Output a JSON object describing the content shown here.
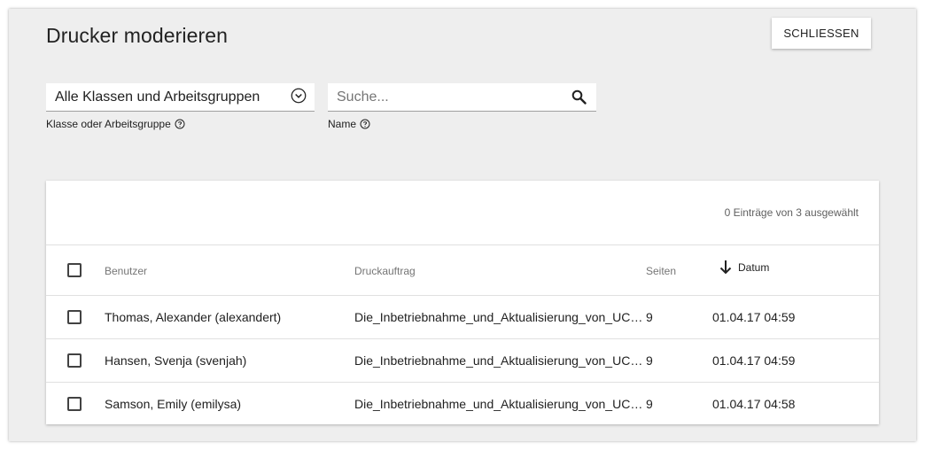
{
  "header": {
    "title": "Drucker moderieren",
    "close_label": "SCHLIESSEN"
  },
  "filters": {
    "class_select": {
      "value": "Alle Klassen und Arbeitsgruppen",
      "label": "Klasse oder Arbeitsgruppe"
    },
    "name_search": {
      "placeholder": "Suche...",
      "value": "",
      "label": "Name"
    }
  },
  "grid": {
    "selection_status": "0 Einträge von 3 ausgewählt",
    "columns": {
      "user": "Benutzer",
      "job": "Druckauftrag",
      "pages": "Seiten",
      "date": "Datum"
    },
    "sort": {
      "column": "date",
      "direction": "descending"
    },
    "rows": [
      {
        "user": "Thomas, Alexander (alexandert)",
        "job": "Die_Inbetriebnahme_und_Aktualisierung_von_UCS_...",
        "pages": "9",
        "date": "01.04.17 04:59"
      },
      {
        "user": "Hansen, Svenja (svenjah)",
        "job": "Die_Inbetriebnahme_und_Aktualisierung_von_UCS_...",
        "pages": "9",
        "date": "01.04.17 04:59"
      },
      {
        "user": "Samson, Emily (emilysa)",
        "job": "Die_Inbetriebnahme_und_Aktualisierung_von_UCS_...",
        "pages": "9",
        "date": "01.04.17 04:58"
      }
    ]
  },
  "icons": {
    "select": "chevron-down-circle-icon",
    "search": "search-icon",
    "help": "help-circle-icon",
    "sort": "arrow-down-icon",
    "checkbox": "checkbox-empty-icon"
  }
}
